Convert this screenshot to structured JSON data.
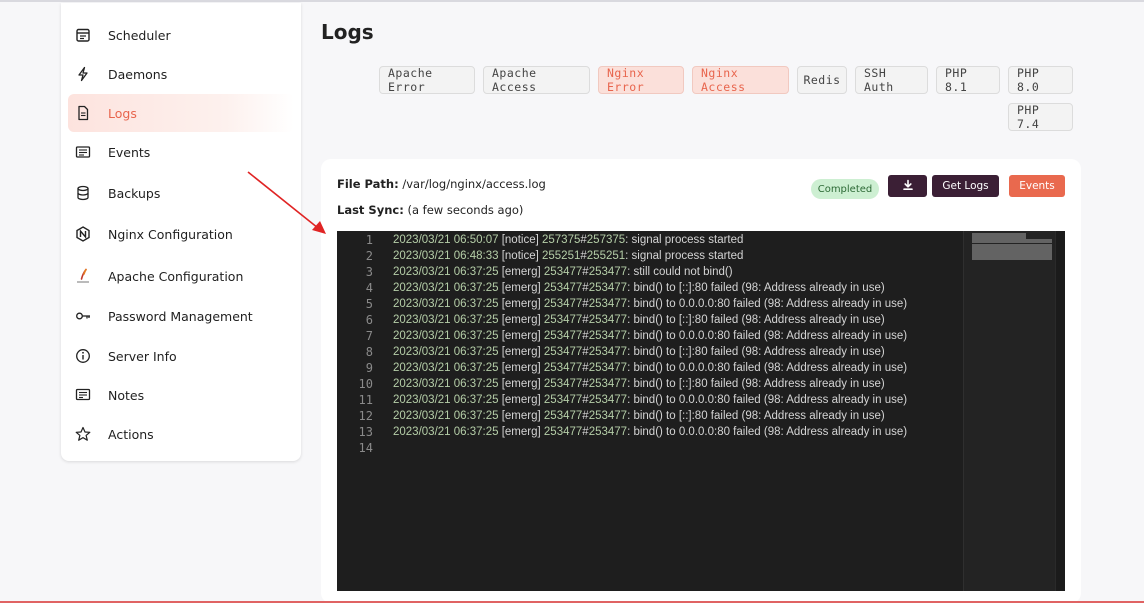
{
  "sidebar": {
    "items": [
      {
        "label": "Scheduler",
        "icon": "calendar-icon",
        "active": false
      },
      {
        "label": "Daemons",
        "icon": "bolt-icon",
        "active": false
      },
      {
        "label": "Logs",
        "icon": "file-icon",
        "active": true
      },
      {
        "label": "Events",
        "icon": "list-icon",
        "active": false
      },
      {
        "label": "Backups",
        "icon": "database-icon",
        "active": false
      },
      {
        "label": "Nginx Configuration",
        "icon": "nginx-icon",
        "active": false
      },
      {
        "label": "Apache Configuration",
        "icon": "apache-icon",
        "active": false
      },
      {
        "label": "Password Management",
        "icon": "key-icon",
        "active": false
      },
      {
        "label": "Server Info",
        "icon": "info-icon",
        "active": false
      },
      {
        "label": "Notes",
        "icon": "notes-icon",
        "active": false
      },
      {
        "label": "Actions",
        "icon": "star-icon",
        "active": false
      }
    ]
  },
  "main": {
    "title": "Logs",
    "tabs": [
      {
        "label": "Apache Error",
        "active": false
      },
      {
        "label": "Apache Access",
        "active": false
      },
      {
        "label": "Nginx Error",
        "active": false
      },
      {
        "label": "Nginx Access",
        "active": true
      },
      {
        "label": "Redis",
        "active": false
      },
      {
        "label": "SSH Auth",
        "active": false
      },
      {
        "label": "PHP 8.1",
        "active": false
      },
      {
        "label": "PHP 8.0",
        "active": false
      },
      {
        "label": "PHP 7.4",
        "active": false
      }
    ],
    "file_path_label": "File Path:",
    "file_path": "/var/log/nginx/access.log",
    "last_sync_label": "Last Sync:",
    "last_sync": "(a few seconds ago)",
    "status_badge": "Completed",
    "download_icon": "download-icon",
    "get_logs_label": "Get Logs",
    "events_label": "Events"
  },
  "log_lines": [
    {
      "n": "1",
      "date": "2023/03/21 06:50:07",
      "level": "[notice]",
      "pid": "257375",
      "tid": "257375",
      "msg": ": signal process started"
    },
    {
      "n": "2",
      "date": "2023/03/21 06:48:33",
      "level": "[notice]",
      "pid": "255251",
      "tid": "255251",
      "msg": ": signal process started"
    },
    {
      "n": "3",
      "date": "2023/03/21 06:37:25",
      "level": "[emerg]",
      "pid": "253477",
      "tid": "253477",
      "msg": ": still could not bind()"
    },
    {
      "n": "4",
      "date": "2023/03/21 06:37:25",
      "level": "[emerg]",
      "pid": "253477",
      "tid": "253477",
      "msg": ": bind() to [::]:80 failed (98: Address already in use)"
    },
    {
      "n": "5",
      "date": "2023/03/21 06:37:25",
      "level": "[emerg]",
      "pid": "253477",
      "tid": "253477",
      "msg": ": bind() to 0.0.0.0:80 failed (98: Address already in use)"
    },
    {
      "n": "6",
      "date": "2023/03/21 06:37:25",
      "level": "[emerg]",
      "pid": "253477",
      "tid": "253477",
      "msg": ": bind() to [::]:80 failed (98: Address already in use)"
    },
    {
      "n": "7",
      "date": "2023/03/21 06:37:25",
      "level": "[emerg]",
      "pid": "253477",
      "tid": "253477",
      "msg": ": bind() to 0.0.0.0:80 failed (98: Address already in use)"
    },
    {
      "n": "8",
      "date": "2023/03/21 06:37:25",
      "level": "[emerg]",
      "pid": "253477",
      "tid": "253477",
      "msg": ": bind() to [::]:80 failed (98: Address already in use)"
    },
    {
      "n": "9",
      "date": "2023/03/21 06:37:25",
      "level": "[emerg]",
      "pid": "253477",
      "tid": "253477",
      "msg": ": bind() to 0.0.0.0:80 failed (98: Address already in use)"
    },
    {
      "n": "10",
      "date": "2023/03/21 06:37:25",
      "level": "[emerg]",
      "pid": "253477",
      "tid": "253477",
      "msg": ": bind() to [::]:80 failed (98: Address already in use)"
    },
    {
      "n": "11",
      "date": "2023/03/21 06:37:25",
      "level": "[emerg]",
      "pid": "253477",
      "tid": "253477",
      "msg": ": bind() to 0.0.0.0:80 failed (98: Address already in use)"
    },
    {
      "n": "12",
      "date": "2023/03/21 06:37:25",
      "level": "[emerg]",
      "pid": "253477",
      "tid": "253477",
      "msg": ": bind() to [::]:80 failed (98: Address already in use)"
    },
    {
      "n": "13",
      "date": "2023/03/21 06:37:25",
      "level": "[emerg]",
      "pid": "253477",
      "tid": "253477",
      "msg": ": bind() to 0.0.0.0:80 failed (98: Address already in use)"
    },
    {
      "n": "14",
      "date": "",
      "level": "",
      "pid": "",
      "tid": "",
      "msg": ""
    }
  ],
  "colors": {
    "accent": "#e8654d",
    "dark_button": "#3b1f35",
    "editor_bg": "#1e1e1e",
    "annotation_arrow": "#e02424"
  }
}
